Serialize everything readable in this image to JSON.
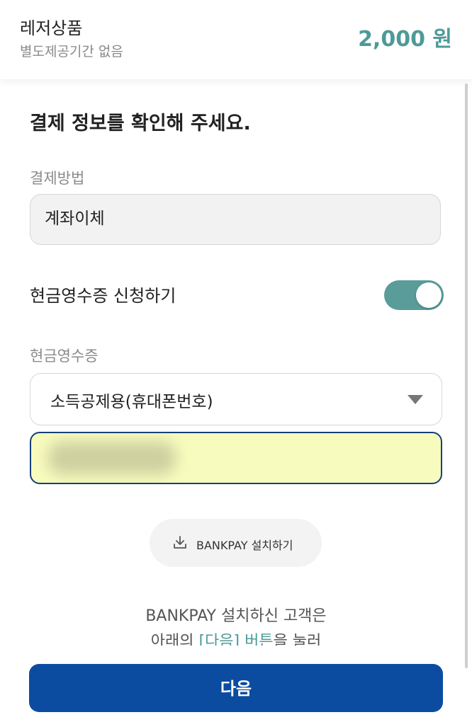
{
  "header": {
    "product_name": "레저상품",
    "product_sub": "별도제공기간 없음",
    "price": "2,000 원"
  },
  "main": {
    "title": "결제 정보를 확인해 주세요.",
    "payment_method_label": "결제방법",
    "payment_method_value": "계좌이체",
    "cash_receipt_toggle_label": "현금영수증 신청하기",
    "cash_receipt_toggle_on": true,
    "cash_receipt_label": "현금영수증",
    "cash_receipt_type": "소득공제용(휴대폰번호)",
    "phone_input_value": "",
    "install_button_label": "BANKPAY 설치하기",
    "info_line1": "BANKPAY 설치하신 고객은",
    "info_line2_prefix": "아래의 ",
    "info_line2_accent": "[다음] 버튼",
    "info_line2_suffix": "을 눌러",
    "next_button_label": "다음"
  },
  "icons": {
    "install": "download-icon",
    "dropdown": "chevron-down-icon"
  },
  "colors": {
    "accent": "#4e9a98",
    "primary_button": "#0c4ca0",
    "toggle_on": "#5a9c99",
    "input_highlight": "#f7fbbd"
  }
}
